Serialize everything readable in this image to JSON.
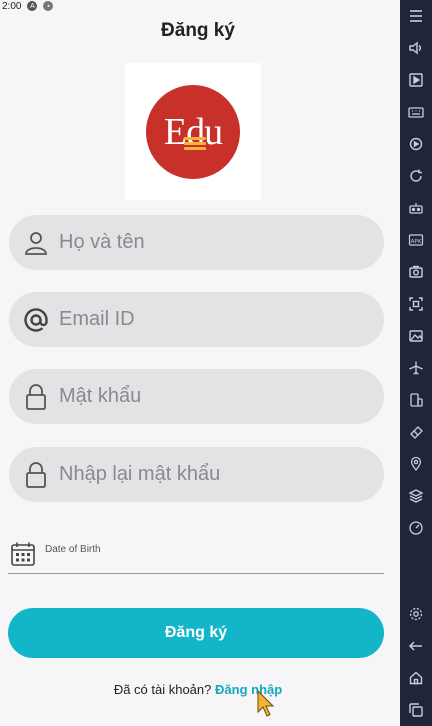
{
  "status": {
    "time": "2:00"
  },
  "header": {
    "title": "Đăng ký"
  },
  "logo": {
    "text": "Edu",
    "colors": {
      "circle": "#c8302a",
      "books": "#f5b53a"
    }
  },
  "form": {
    "full_name": {
      "placeholder": "Họ và tên",
      "icon": "person-icon"
    },
    "email": {
      "placeholder": "Email ID",
      "icon": "at-icon"
    },
    "password": {
      "placeholder": "Mật khẩu",
      "icon": "lock-icon"
    },
    "confirm_password": {
      "placeholder": "Nhập lại mật khẩu",
      "icon": "lock-icon"
    },
    "dob": {
      "label": "Date of Birth",
      "icon": "calendar-icon"
    },
    "submit_label": "Đăng ký"
  },
  "footer": {
    "prompt": "Đã có tài khoản?",
    "login_link": "Đăng nhập"
  },
  "colors": {
    "accent": "#13b5c8",
    "link": "#13a8c0",
    "sidebar": "#20253a"
  },
  "sidebar": {
    "items": [
      "menu-icon",
      "volume-icon",
      "play-icon",
      "keyboard-icon",
      "rotate-icon",
      "sync-icon",
      "robot-icon",
      "apk-icon",
      "screenshot-icon",
      "crop-icon",
      "folder-icon",
      "airplane-icon",
      "multi-instance-icon",
      "erase-icon",
      "location-icon",
      "layers-icon",
      "speed-icon"
    ],
    "bottom_items": [
      "settings-icon",
      "back-icon",
      "home-icon",
      "recents-icon"
    ]
  }
}
